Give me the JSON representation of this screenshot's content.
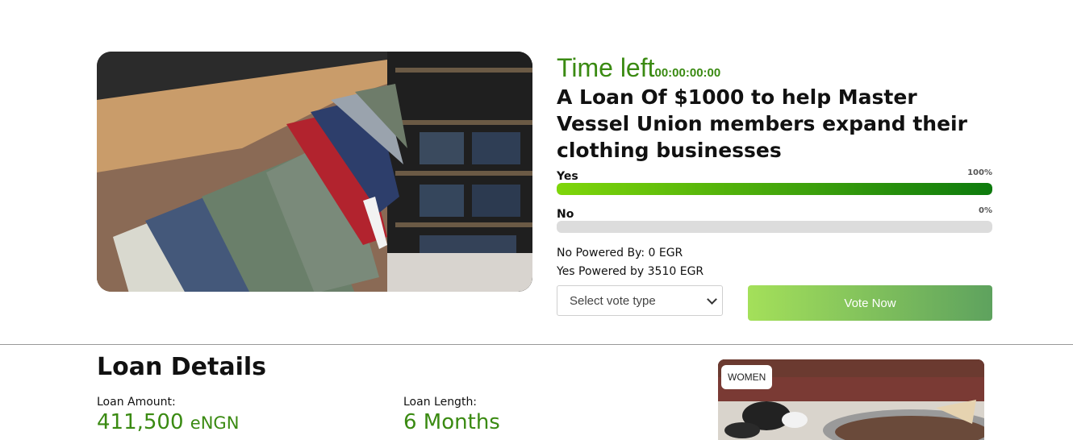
{
  "campaign": {
    "time_left_label": "Time left",
    "time_left_value": "00:00:00:00",
    "title": "A Loan Of $1000 to help Master Vessel Union members expand their clothing businesses"
  },
  "votes": {
    "yes": {
      "label": "Yes",
      "percent_text": "100%",
      "percent": 100
    },
    "no": {
      "label": "No",
      "percent_text": "0%",
      "percent": 0
    }
  },
  "powered": {
    "no_text": "No Powered By: 0 EGR",
    "yes_text": "Yes Powered by 3510 EGR"
  },
  "controls": {
    "select_placeholder": "Select vote type",
    "vote_button": "Vote Now"
  },
  "loan_details": {
    "heading": "Loan Details",
    "amount_label": "Loan Amount:",
    "amount_value": "411,500",
    "amount_unit": "eNGN",
    "length_label": "Loan Length:",
    "length_value": "6 Months"
  },
  "card": {
    "badge": "WOMEN"
  },
  "colors": {
    "accent_green": "#3a8a12",
    "bar_start": "#7fd60a",
    "bar_end": "#0d7a0d",
    "button_start": "#a4e05a",
    "button_end": "#5ea25e"
  }
}
